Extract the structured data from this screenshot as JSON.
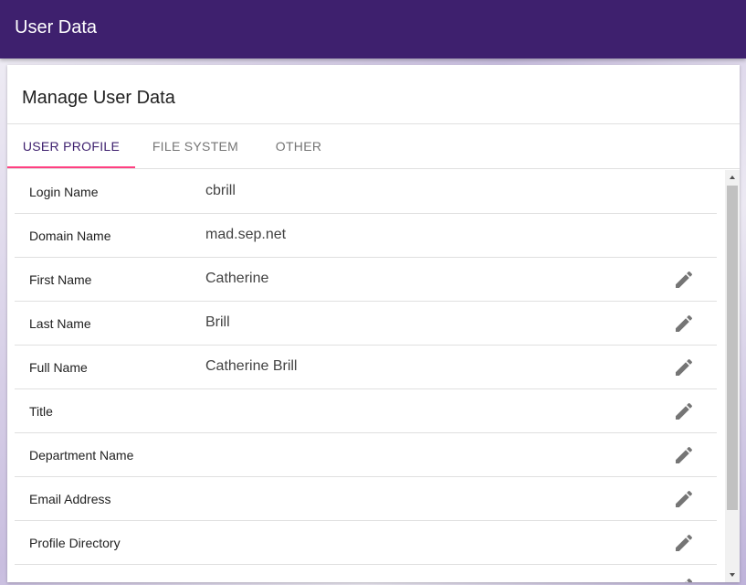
{
  "appbar": {
    "title": "User Data"
  },
  "card": {
    "title": "Manage User Data"
  },
  "tabs": [
    {
      "label": "USER PROFILE",
      "active": true
    },
    {
      "label": "FILE SYSTEM",
      "active": false
    },
    {
      "label": "OTHER",
      "active": false
    }
  ],
  "colors": {
    "appbar": "#3e206e",
    "tab_active_text": "#3e206e",
    "tab_indicator": "#ff4081",
    "icon": "#757575"
  },
  "rows": [
    {
      "label": "Login Name",
      "value": "cbrill",
      "editable": false
    },
    {
      "label": "Domain Name",
      "value": "mad.sep.net",
      "editable": false
    },
    {
      "label": "First Name",
      "value": "Catherine",
      "editable": true
    },
    {
      "label": "Last Name",
      "value": "Brill",
      "editable": true
    },
    {
      "label": "Full Name",
      "value": "Catherine Brill",
      "editable": true
    },
    {
      "label": "Title",
      "value": "",
      "editable": true
    },
    {
      "label": "Department Name",
      "value": "",
      "editable": true
    },
    {
      "label": "Email Address",
      "value": "",
      "editable": true
    },
    {
      "label": "Profile Directory",
      "value": "",
      "editable": true
    }
  ],
  "icons": {
    "edit": "pencil-icon",
    "scroll_up": "arrow-up-icon",
    "scroll_down": "arrow-down-icon"
  }
}
